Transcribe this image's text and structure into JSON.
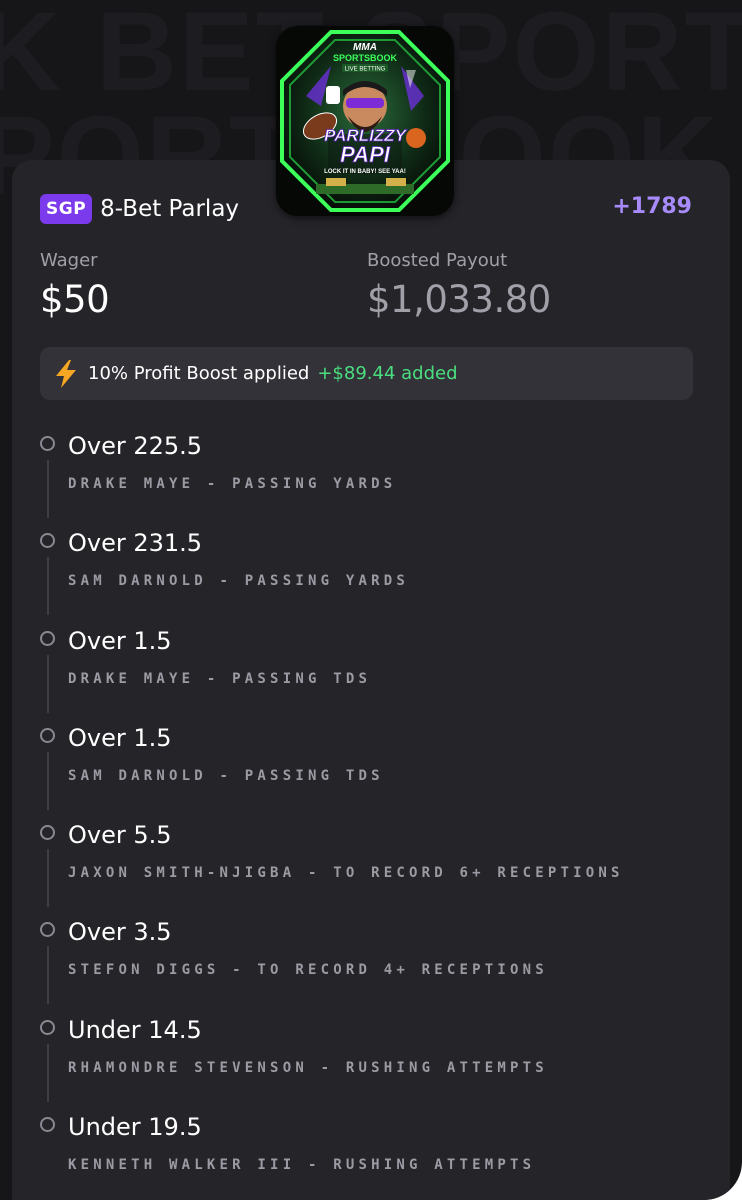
{
  "background_watermark": [
    "K BET SPORTSBO",
    "PORTSBOOK HAR"
  ],
  "logo": {
    "top_text": "MMA",
    "brand": "SPORTSBOOK",
    "tag": "LIVE BETTING",
    "name_line1": "PARLIZZY",
    "name_line2": "PAPI",
    "slogan": "LOCK IT IN BABY! SEE YAA!"
  },
  "bet": {
    "badge": "SGP",
    "title": "8-Bet Parlay",
    "odds": "+1789",
    "wager_label": "Wager",
    "wager_value": "$50",
    "payout_label": "Boosted Payout",
    "payout_value": "$1,033.80"
  },
  "boost": {
    "text": "10% Profit Boost applied",
    "added": "+$89.44 added",
    "icon": "lightning-bolt-icon"
  },
  "legs": [
    {
      "line": "Over 225.5",
      "desc": "DRAKE MAYE - PASSING YARDS"
    },
    {
      "line": "Over 231.5",
      "desc": "SAM DARNOLD - PASSING YARDS"
    },
    {
      "line": "Over 1.5",
      "desc": "DRAKE MAYE - PASSING TDS"
    },
    {
      "line": "Over 1.5",
      "desc": "SAM DARNOLD - PASSING TDS"
    },
    {
      "line": "Over 5.5",
      "desc": "JAXON SMITH-NJIGBA - TO RECORD 6+ RECEPTIONS"
    },
    {
      "line": "Over 3.5",
      "desc": "STEFON DIGGS - TO RECORD 4+ RECEPTIONS"
    },
    {
      "line": "Under 14.5",
      "desc": "RHAMONDRE STEVENSON - RUSHING ATTEMPTS"
    },
    {
      "line": "Under 19.5",
      "desc": "KENNETH WALKER III - RUSHING ATTEMPTS"
    }
  ],
  "colors": {
    "background": "#161518",
    "card": "#252429",
    "accent_purple": "#7c3aed",
    "odds_purple": "#a78bfa",
    "boost_green": "#4ade80",
    "bolt_orange": "#f5a623",
    "logo_neon": "#3cff5a"
  }
}
